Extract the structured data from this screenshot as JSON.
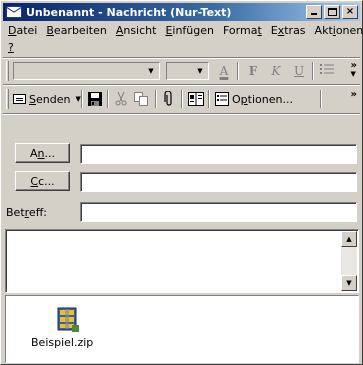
{
  "window": {
    "title": "Unbenannt - Nachricht (Nur-Text)",
    "buttons": {
      "minimize": "_",
      "maximize": "□",
      "close": "×"
    }
  },
  "menu": {
    "datei": {
      "u": "D",
      "rest": "atei"
    },
    "bearbeiten": {
      "u": "B",
      "rest": "earbeiten"
    },
    "ansicht": {
      "u": "A",
      "rest": "nsicht"
    },
    "einfuegen": {
      "u": "E",
      "rest": "infügen"
    },
    "format": {
      "pre": "Forma",
      "u": "t",
      "rest": ""
    },
    "extras": {
      "pre": "E",
      "u": "x",
      "rest": "tras"
    },
    "aktionen": {
      "pre": "Akt",
      "u": "i",
      "rest": "onen"
    },
    "help": {
      "u": "?"
    }
  },
  "format_toolbar": {
    "font_value": "",
    "size_value": "",
    "color_icon": "A",
    "bold": "F",
    "italic": "K",
    "underline": "U",
    "more": "»"
  },
  "std_toolbar": {
    "send": {
      "u": "S",
      "rest": "enden"
    },
    "options": {
      "pre": "O",
      "u": "p",
      "rest": "tionen..."
    },
    "icons": [
      "save-icon",
      "cut-icon",
      "copy-icon",
      "attach-icon",
      "address-book-icon",
      "options-icon"
    ],
    "more": "»"
  },
  "address": {
    "to": {
      "pre": "A",
      "u": "n",
      "rest": "...",
      "value": ""
    },
    "cc": {
      "pre": "",
      "u": "C",
      "rest": "c...",
      "value": ""
    },
    "subject": {
      "pre": "Bet",
      "u": "r",
      "rest": "eff:",
      "value": ""
    }
  },
  "body_text": "",
  "attachment": {
    "filename": "Beispiel.zip"
  },
  "colors": {
    "title_start": "#0a246a",
    "title_end": "#a6caf0",
    "face": "#d4d0c8"
  }
}
